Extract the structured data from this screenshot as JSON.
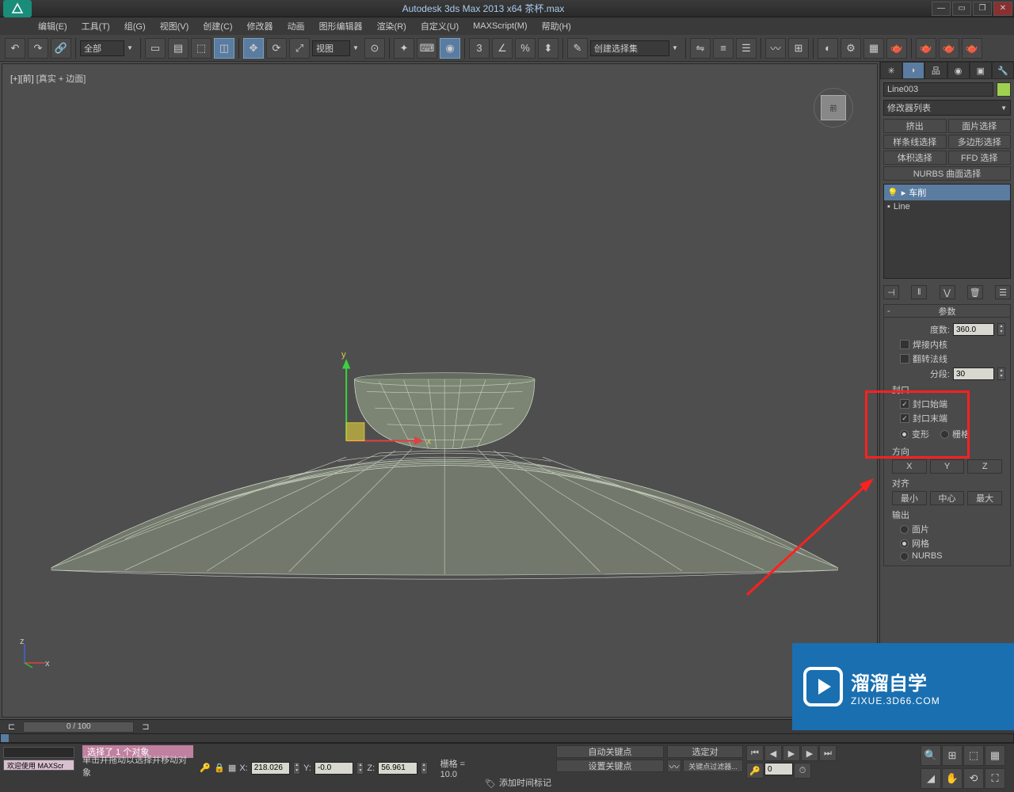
{
  "title": "Autodesk 3ds Max  2013 x64     茶杯.max",
  "menu": [
    "编辑(E)",
    "工具(T)",
    "组(G)",
    "视图(V)",
    "创建(C)",
    "修改器",
    "动画",
    "图形编辑器",
    "渲染(R)",
    "自定义(U)",
    "MAXScript(M)",
    "帮助(H)"
  ],
  "toolbar": {
    "selection_filter": "全部",
    "ref_coord": "视图",
    "named_sel": "创建选择集"
  },
  "viewport": {
    "label_prefix": "[+][前]",
    "label_shaded": "[真实 + 边面]",
    "viewcube_face": "前"
  },
  "cmdpanel": {
    "object_name": "Line003",
    "modifier_list": "修改器列表",
    "mod_buttons": [
      "挤出",
      "面片选择",
      "样条线选择",
      "多边形选择",
      "体积选择",
      "FFD 选择",
      "NURBS 曲面选择"
    ],
    "stack": {
      "item0": "车削",
      "item1": "Line"
    },
    "rollout_params_title": "参数",
    "degrees_label": "度数:",
    "degrees_value": "360.0",
    "weld_core": "焊接内核",
    "flip_normals": "翻转法线",
    "segments_label": "分段:",
    "segments_value": "30",
    "cap_group": "封口",
    "cap_start": "封口始端",
    "cap_end": "封口末端",
    "morph": "变形",
    "grid": "栅格",
    "direction_group": "方向",
    "dir_x": "X",
    "dir_y": "Y",
    "dir_z": "Z",
    "align_group": "对齐",
    "align_min": "最小",
    "align_center": "中心",
    "align_max": "最大",
    "output_group": "输出",
    "out_patch": "面片",
    "out_mesh": "网格",
    "out_nurbs": "NURBS"
  },
  "timeline": {
    "slider": "0 / 100"
  },
  "status": {
    "selected_count": "选择了 1 个对象",
    "welcome": "欢迎使用  MAXScr",
    "prompt": "单击并拖动以选择并移动对象",
    "x": "218.026",
    "y": "-0.0",
    "z": "56.961",
    "grid": "栅格 = 10.0",
    "add_time_tag": "添加时间标记",
    "autokey": "自动关键点",
    "setkey": "设置关键点",
    "selected_label": "选定对",
    "keyfilter": "关键点过滤器..."
  },
  "watermark": {
    "big": "溜溜自学",
    "small": "ZIXUE.3D66.COM"
  }
}
